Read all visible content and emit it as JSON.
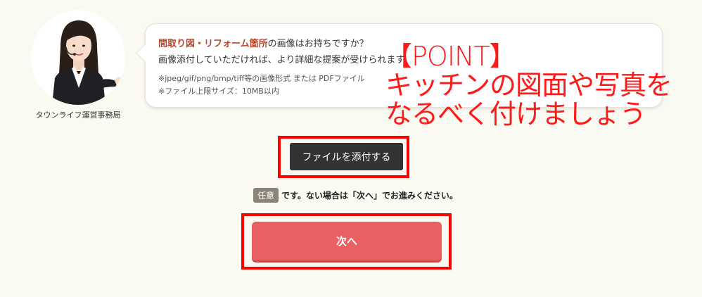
{
  "agent": {
    "caption": "タウンライフ運営事務局"
  },
  "bubble": {
    "highlight": "間取り図・リフォーム箇所",
    "question_rest": "の画像はお持ちですか？",
    "line2": "画像添付していただければ、より詳細な提案が受けられます。",
    "note1": "※jpeg/gif/png/bmp/tiff等の画像形式 または PDFファイル",
    "note2": "※ファイル上限サイズ：10MB以内"
  },
  "overlay": {
    "line1": "【POINT】",
    "line2": "キッチンの図面や写真を",
    "line3": "なるべく付けましょう"
  },
  "upload": {
    "button_label": "ファイルを添付する"
  },
  "optional": {
    "badge": "任意",
    "text": "です。ない場合は「次へ」でお進みください。"
  },
  "next": {
    "button_label": "次へ"
  },
  "colors": {
    "background": "#fbfaf2",
    "highlight": "#b5482f",
    "overlay_red": "#ff1a1a",
    "next_button": "#e96063",
    "upload_button": "#333333"
  }
}
